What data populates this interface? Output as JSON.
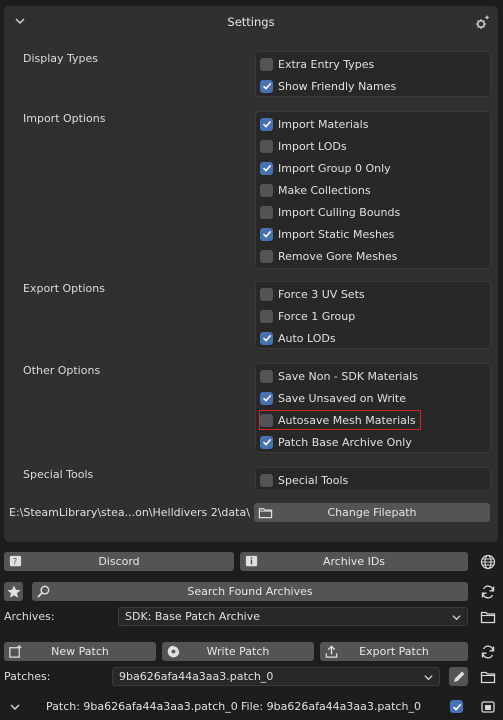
{
  "panel": {
    "title": "Settings",
    "sections": [
      {
        "label": "Display Types",
        "options": [
          {
            "label": "Extra Entry Types",
            "checked": false
          },
          {
            "label": "Show Friendly Names",
            "checked": true
          }
        ]
      },
      {
        "label": "Import Options",
        "options": [
          {
            "label": "Import Materials",
            "checked": true
          },
          {
            "label": "Import LODs",
            "checked": false
          },
          {
            "label": "Import Group 0 Only",
            "checked": true
          },
          {
            "label": "Make Collections",
            "checked": false
          },
          {
            "label": "Import Culling Bounds",
            "checked": false
          },
          {
            "label": "Import Static Meshes",
            "checked": true
          },
          {
            "label": "Remove Gore Meshes",
            "checked": false
          }
        ]
      },
      {
        "label": "Export Options",
        "options": [
          {
            "label": "Force 3 UV Sets",
            "checked": false
          },
          {
            "label": "Force 1 Group",
            "checked": false
          },
          {
            "label": "Auto LODs",
            "checked": true
          }
        ]
      },
      {
        "label": "Other Options",
        "options": [
          {
            "label": "Save Non - SDK Materials",
            "checked": false
          },
          {
            "label": "Save Unsaved on Write",
            "checked": true
          },
          {
            "label": "Autosave Mesh Materials",
            "checked": false,
            "highlighted": true
          },
          {
            "label": "Patch Base Archive Only",
            "checked": true
          }
        ]
      },
      {
        "label": "Special Tools",
        "options": [
          {
            "label": "Special Tools",
            "checked": false
          }
        ]
      }
    ],
    "filepath": "E:\\SteamLibrary\\stea...on\\Helldivers 2\\data\\",
    "change_filepath_label": "Change Filepath"
  },
  "toolbar": {
    "discord_label": "Discord",
    "archive_ids_label": "Archive IDs",
    "search_label": "Search Found Archives",
    "archives_label": "Archives:",
    "archives_value": "SDK: Base Patch Archive",
    "new_patch_label": "New Patch",
    "write_patch_label": "Write Patch",
    "export_patch_label": "Export Patch",
    "patches_label": "Patches:",
    "patches_value": "9ba626afa44a3aa3.patch_0"
  },
  "bottom": {
    "patch_text": "Patch: 9ba626afa44a3aa3.patch_0",
    "file_text": "File: 9ba626afa44a3aa3.patch_0",
    "checked": true
  },
  "colors": {
    "accent": "#4772b3",
    "highlight": "#d22a2a"
  }
}
